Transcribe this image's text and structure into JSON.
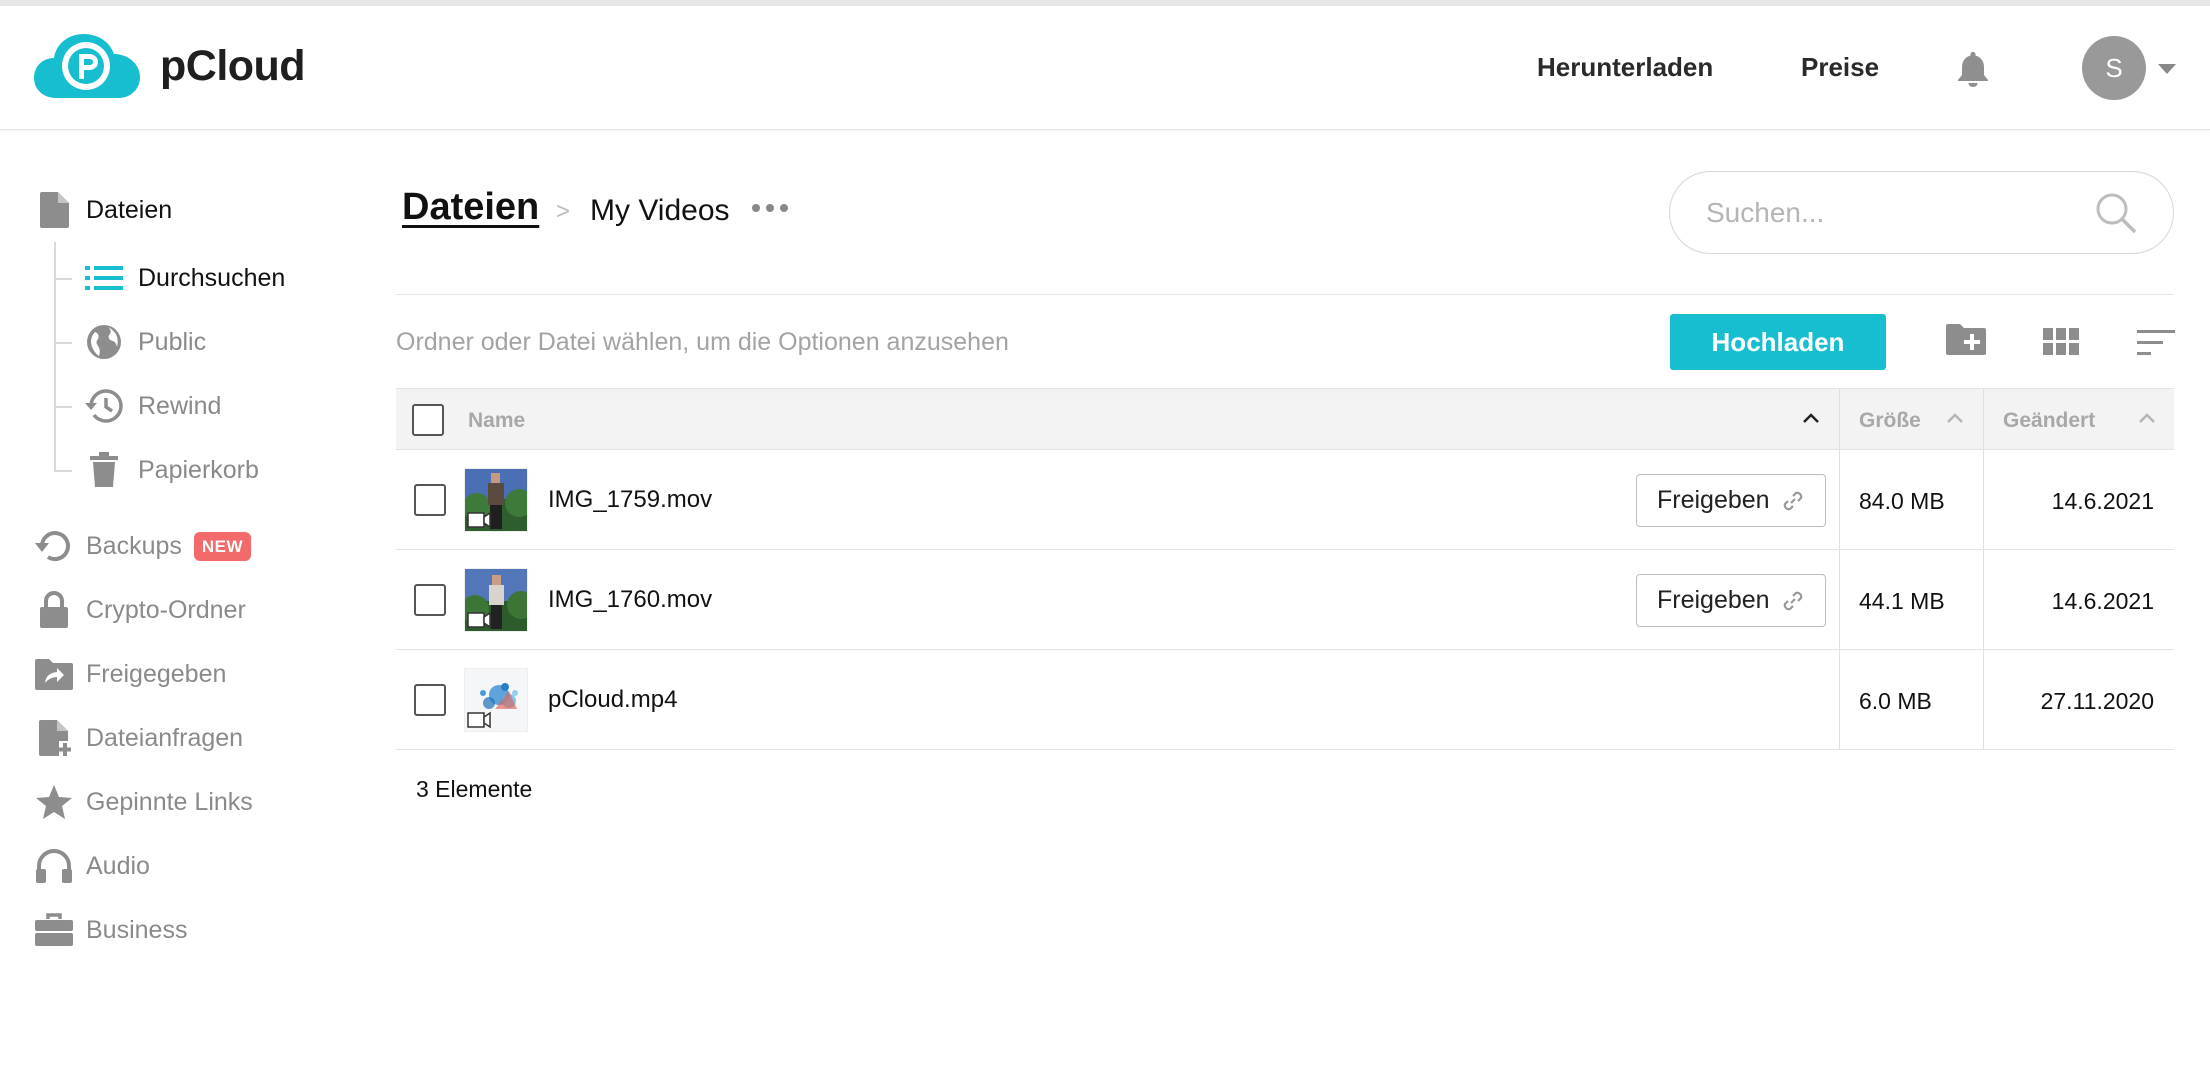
{
  "header": {
    "brand": "pCloud",
    "nav_download": "Herunterladen",
    "nav_prices": "Preise",
    "avatar_initial": "S",
    "accent_color": "#17bed0"
  },
  "sidebar": {
    "files_label": "Dateien",
    "sub_items": [
      {
        "label": "Durchsuchen",
        "icon": "list-icon",
        "active": true
      },
      {
        "label": "Public",
        "icon": "globe-icon"
      },
      {
        "label": "Rewind",
        "icon": "history-icon"
      },
      {
        "label": "Papierkorb",
        "icon": "trash-icon"
      }
    ],
    "items": [
      {
        "label": "Backups",
        "icon": "backup-icon",
        "badge": "NEW"
      },
      {
        "label": "Crypto-Ordner",
        "icon": "lock-icon"
      },
      {
        "label": "Freigegeben",
        "icon": "shared-folder-icon"
      },
      {
        "label": "Dateianfragen",
        "icon": "file-request-icon"
      },
      {
        "label": "Gepinnte Links",
        "icon": "star-icon"
      },
      {
        "label": "Audio",
        "icon": "headphones-icon"
      },
      {
        "label": "Business",
        "icon": "briefcase-icon"
      }
    ]
  },
  "breadcrumb": {
    "root": "Dateien",
    "separator": ">",
    "current": "My Videos"
  },
  "search": {
    "placeholder": "Suchen..."
  },
  "toolbar": {
    "hint": "Ordner oder Datei wählen, um die Optionen anzusehen",
    "upload_label": "Hochladen"
  },
  "table": {
    "columns": {
      "name": "Name",
      "size": "Größe",
      "modified": "Geändert"
    },
    "rows": [
      {
        "name": "IMG_1759.mov",
        "size": "84.0 MB",
        "modified": "14.6.2021",
        "share_label": "Freigeben"
      },
      {
        "name": "IMG_1760.mov",
        "size": "44.1 MB",
        "modified": "14.6.2021",
        "share_label": "Freigeben"
      },
      {
        "name": "pCloud.mp4",
        "size": "6.0 MB",
        "modified": "27.11.2020"
      }
    ],
    "count_label": "3 Elemente"
  }
}
